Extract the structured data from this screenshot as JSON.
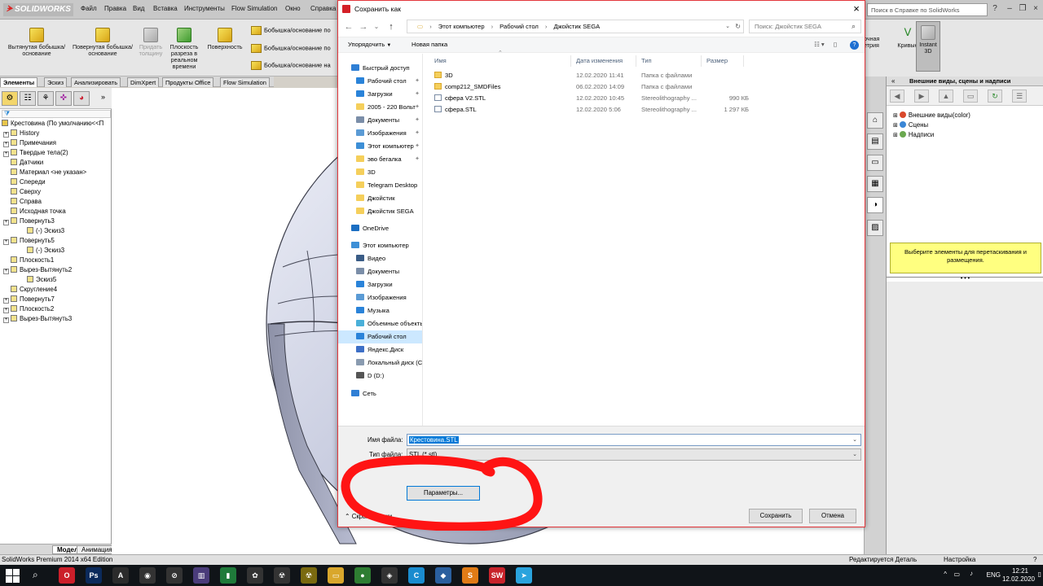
{
  "app": {
    "logo": "SOLIDWORKS",
    "menu": [
      "Файл",
      "Правка",
      "Вид",
      "Вставка",
      "Инструменты",
      "Flow Simulation",
      "Окно",
      "Справка"
    ],
    "help_search_placeholder": "Поиск в Справке по SolidWorks"
  },
  "ribbon": {
    "buttons": [
      {
        "label": "Вытянутая бобышка/основание"
      },
      {
        "label": "Повернутая бобышка/основание"
      },
      {
        "label": "Придать толщину"
      },
      {
        "label": "Плоскость разреза в реальном времени"
      },
      {
        "label": "Поверхность"
      }
    ],
    "small": [
      "Бобышка/основание по",
      "Бобышка/основание по",
      "Бобышка/основание на"
    ],
    "right": {
      "partial_label": "очная етрия",
      "curves_label": "Кривые",
      "instant3d_label": "Instant 3D"
    }
  },
  "left_tabs": [
    "Элементы",
    "Эскиз",
    "Анализировать",
    "DimXpert",
    "Продукты Office",
    "Flow Simulation"
  ],
  "tree": {
    "root": "Крестовина  (По умолчанию<<П",
    "items": [
      {
        "label": "History",
        "indent": 1,
        "expand": true
      },
      {
        "label": "Примечания",
        "indent": 1,
        "expand": true
      },
      {
        "label": "Твердые тела(2)",
        "indent": 1,
        "expand": true
      },
      {
        "label": "Датчики",
        "indent": 1,
        "expand": false
      },
      {
        "label": "Материал <не указан>",
        "indent": 1,
        "expand": false
      },
      {
        "label": "Спереди",
        "indent": 1,
        "expand": false
      },
      {
        "label": "Сверху",
        "indent": 1,
        "expand": false
      },
      {
        "label": "Справа",
        "indent": 1,
        "expand": false
      },
      {
        "label": "Исходная точка",
        "indent": 1,
        "expand": false
      },
      {
        "label": "Повернуть3",
        "indent": 1,
        "expand": true
      },
      {
        "label": "(-) Эскиз3",
        "indent": 2,
        "expand": false
      },
      {
        "label": "Повернуть5",
        "indent": 1,
        "expand": true
      },
      {
        "label": "(-) Эскиз3",
        "indent": 2,
        "expand": false
      },
      {
        "label": "Плоскость1",
        "indent": 1,
        "expand": false
      },
      {
        "label": "Вырез-Вытянуть2",
        "indent": 1,
        "expand": true
      },
      {
        "label": "Эскиз5",
        "indent": 2,
        "expand": false
      },
      {
        "label": "Скругление4",
        "indent": 1,
        "expand": false
      },
      {
        "label": "Повернуть7",
        "indent": 1,
        "expand": true
      },
      {
        "label": "Плоскость2",
        "indent": 1,
        "expand": true
      },
      {
        "label": "Вырез-Вытянуть3",
        "indent": 1,
        "expand": true
      }
    ]
  },
  "bottom_tabs": [
    "Модель",
    "Анимация"
  ],
  "right_pane": {
    "title": "Внешние виды, сцены и надписи",
    "items": [
      {
        "label": "Внешние виды(color)",
        "color": "#d9482b"
      },
      {
        "label": "Сцены",
        "color": "#3a86d6"
      },
      {
        "label": "Надписи",
        "color": "#6aa84f"
      }
    ],
    "hint": "Выберите элементы для перетаскивания и размещения."
  },
  "dialog": {
    "title": "Сохранить как",
    "breadcrumbs": [
      "Этот компьютер",
      "Рабочий стол",
      "Джойстик SEGA"
    ],
    "search_placeholder": "Поиск: Джойстик SEGA",
    "organize_label": "Упорядочить",
    "new_folder_label": "Новая папка",
    "nav_items": [
      {
        "label": "Быстрый доступ",
        "icon": "star-icon",
        "color": "#2f7fd5",
        "indent": 0,
        "pin": false,
        "selected": false
      },
      {
        "label": "Рабочий стол",
        "icon": "desktop-icon",
        "color": "#2a83d9",
        "indent": 1,
        "pin": true,
        "selected": false
      },
      {
        "label": "Загрузки",
        "icon": "download-icon",
        "color": "#2a83d9",
        "indent": 1,
        "pin": true,
        "selected": false
      },
      {
        "label": "2005 - 220 Вольт",
        "icon": "folder-icon",
        "color": "#f5cf5b",
        "indent": 1,
        "pin": true,
        "selected": false
      },
      {
        "label": "Документы",
        "icon": "documents-icon",
        "color": "#7b8ea8",
        "indent": 1,
        "pin": true,
        "selected": false
      },
      {
        "label": "Изображения",
        "icon": "pictures-icon",
        "color": "#5b9bd5",
        "indent": 1,
        "pin": true,
        "selected": false
      },
      {
        "label": "Этот компьютер",
        "icon": "computer-icon",
        "color": "#3d8fd6",
        "indent": 1,
        "pin": true,
        "selected": false
      },
      {
        "label": "эво бегалка",
        "icon": "folder-icon",
        "color": "#f5cf5b",
        "indent": 1,
        "pin": true,
        "selected": false
      },
      {
        "label": "3D",
        "icon": "folder-icon",
        "color": "#f5cf5b",
        "indent": 1,
        "pin": false,
        "selected": false
      },
      {
        "label": "Telegram Desktop",
        "icon": "folder-icon",
        "color": "#f5cf5b",
        "indent": 1,
        "pin": false,
        "selected": false
      },
      {
        "label": "Джойстик",
        "icon": "folder-icon",
        "color": "#f5cf5b",
        "indent": 1,
        "pin": false,
        "selected": false
      },
      {
        "label": "Джойстик SEGA",
        "icon": "folder-icon",
        "color": "#f5cf5b",
        "indent": 1,
        "pin": false,
        "selected": false
      },
      {
        "label": "OneDrive",
        "icon": "cloud-icon",
        "color": "#1b6ec2",
        "indent": 0,
        "pin": false,
        "selected": false
      },
      {
        "label": "Этот компьютер",
        "icon": "computer-icon",
        "color": "#3d8fd6",
        "indent": 0,
        "pin": false,
        "selected": false
      },
      {
        "label": "Видео",
        "icon": "video-icon",
        "color": "#3a5c86",
        "indent": 1,
        "pin": false,
        "selected": false
      },
      {
        "label": "Документы",
        "icon": "documents-icon",
        "color": "#7b8ea8",
        "indent": 1,
        "pin": false,
        "selected": false
      },
      {
        "label": "Загрузки",
        "icon": "download-icon",
        "color": "#2a83d9",
        "indent": 1,
        "pin": false,
        "selected": false
      },
      {
        "label": "Изображения",
        "icon": "pictures-icon",
        "color": "#5b9bd5",
        "indent": 1,
        "pin": false,
        "selected": false
      },
      {
        "label": "Музыка",
        "icon": "music-icon",
        "color": "#2a83d9",
        "indent": 1,
        "pin": false,
        "selected": false
      },
      {
        "label": "Объемные объекты",
        "icon": "3d-objects-icon",
        "color": "#4ab0d9",
        "indent": 1,
        "pin": false,
        "selected": false
      },
      {
        "label": "Рабочий стол",
        "icon": "desktop-icon",
        "color": "#2a83d9",
        "indent": 1,
        "pin": false,
        "selected": true
      },
      {
        "label": "Яндекс.Диск",
        "icon": "yandex-disk-icon",
        "color": "#3d6fc7",
        "indent": 1,
        "pin": false,
        "selected": false
      },
      {
        "label": "Локальный диск (C:)",
        "icon": "drive-icon",
        "color": "#8a9bb0",
        "indent": 1,
        "pin": false,
        "selected": false
      },
      {
        "label": "D (D:)",
        "icon": "drive-icon",
        "color": "#555",
        "indent": 1,
        "pin": false,
        "selected": false
      },
      {
        "label": "Сеть",
        "icon": "network-icon",
        "color": "#2f7fd5",
        "indent": 0,
        "pin": false,
        "selected": false
      }
    ],
    "columns": [
      "Имя",
      "Дата изменения",
      "Тип",
      "Размер"
    ],
    "files": [
      {
        "name": "3D",
        "date": "12.02.2020 11:41",
        "type": "Папка с файлами",
        "size": "",
        "kind": "folder"
      },
      {
        "name": "comp212_SMDFiles",
        "date": "06.02.2020 14:09",
        "type": "Папка с файлами",
        "size": "",
        "kind": "folder"
      },
      {
        "name": "сфера V2.STL",
        "date": "12.02.2020 10:45",
        "type": "Stereolithography ...",
        "size": "990 КБ",
        "kind": "stl"
      },
      {
        "name": "сфера.STL",
        "date": "12.02.2020 5:06",
        "type": "Stereolithography ...",
        "size": "1 297 КБ",
        "kind": "stl"
      }
    ],
    "filename_label": "Имя файла:",
    "filename_value": "Крестовина.STL",
    "filetype_label": "Тип файла:",
    "filetype_value": "STL (*.stl)",
    "params_button": "Параметры...",
    "hide_folders": "Скрыть папки",
    "save_button": "Сохранить",
    "cancel_button": "Отмена"
  },
  "statusbar": {
    "left": "SolidWorks Premium 2014 x64 Edition",
    "editing": "Редактируется Деталь",
    "settings": "Настройка"
  },
  "taskbar": {
    "apps": [
      {
        "icon": "opera-icon",
        "glyph": "O",
        "color": "#cc1f2a"
      },
      {
        "icon": "photoshop-icon",
        "glyph": "Ps",
        "color": "#0b2a5b"
      },
      {
        "icon": "archicad-icon",
        "glyph": "A",
        "color": "#2b2b2b"
      },
      {
        "icon": "app-icon",
        "glyph": "◉",
        "color": "#333"
      },
      {
        "icon": "compass-icon",
        "glyph": "⊘",
        "color": "#333"
      },
      {
        "icon": "app-icon",
        "glyph": "▥",
        "color": "#4a3c7a"
      },
      {
        "icon": "chart-icon",
        "glyph": "▮",
        "color": "#1f7a3a"
      },
      {
        "icon": "paint-icon",
        "glyph": "✿",
        "color": "#333"
      },
      {
        "icon": "radiation-icon",
        "glyph": "☢",
        "color": "#333"
      },
      {
        "icon": "radiation-icon",
        "glyph": "☢",
        "color": "#7a6a10"
      },
      {
        "icon": "explorer-icon",
        "glyph": "▭",
        "color": "#d9a72c"
      },
      {
        "icon": "chrome-icon",
        "glyph": "●",
        "color": "#2e7d32"
      },
      {
        "icon": "3d-builder-icon",
        "glyph": "◈",
        "color": "#333"
      },
      {
        "icon": "app-icon",
        "glyph": "C",
        "color": "#1a8ccf"
      },
      {
        "icon": "app-icon",
        "glyph": "◆",
        "color": "#2a5f9e"
      },
      {
        "icon": "sublime-icon",
        "glyph": "S",
        "color": "#e07b16"
      },
      {
        "icon": "solidworks-icon",
        "glyph": "SW",
        "color": "#c8232b"
      },
      {
        "icon": "telegram-icon",
        "glyph": "➤",
        "color": "#2aa3dd"
      }
    ],
    "lang": "ENG",
    "time": "12:21",
    "date": "12.02.2020"
  }
}
